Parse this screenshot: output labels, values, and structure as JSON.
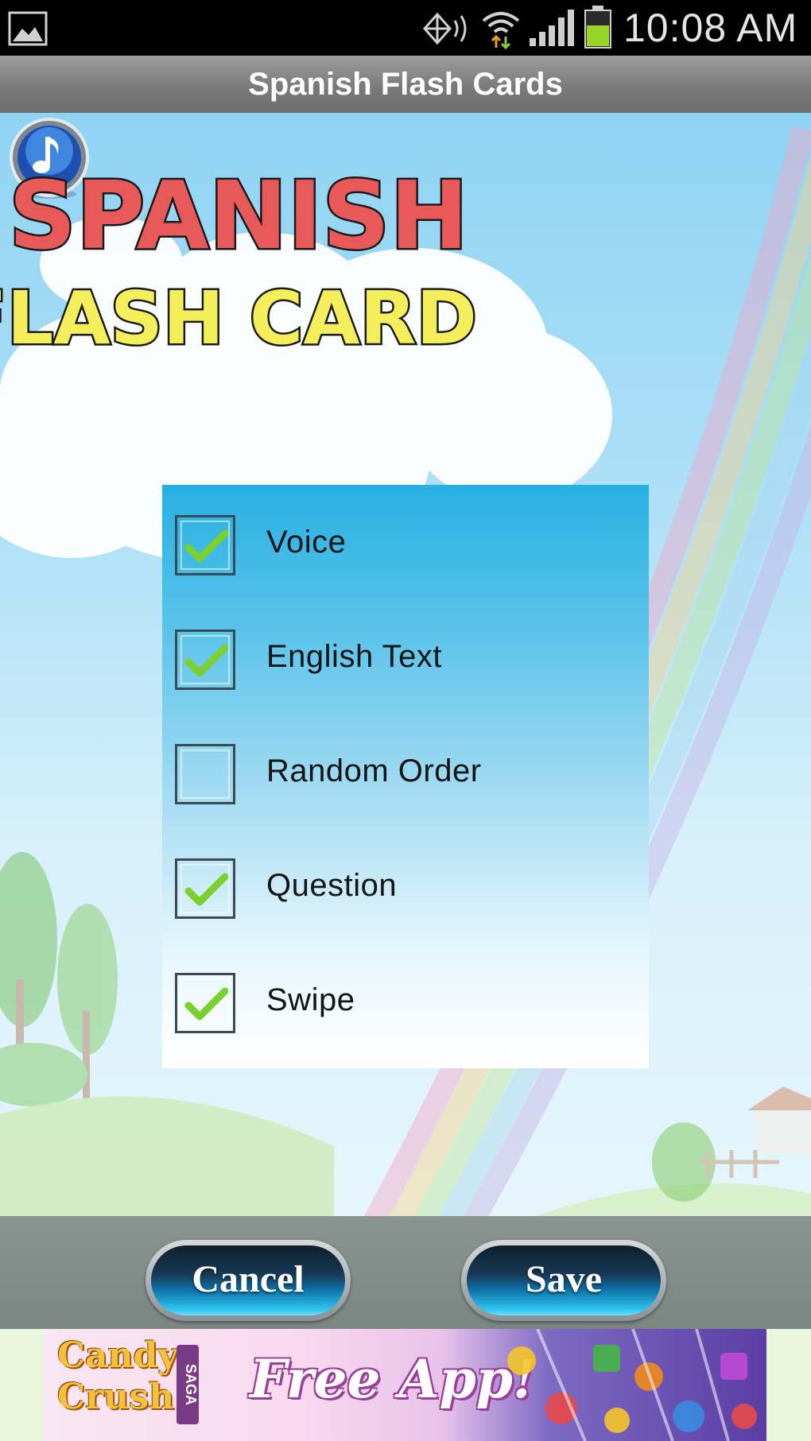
{
  "status_bar": {
    "time": "10:08 AM",
    "icons": [
      "gallery-icon",
      "sync-icon",
      "wifi-icon",
      "signal-icon",
      "battery-icon"
    ]
  },
  "title_bar": {
    "title": "Spanish Flash Cards"
  },
  "logo": {
    "line1": "SPANISH",
    "line2": "FLASH CARDS",
    "colors": {
      "line1": "#e85a5a",
      "line2": "#f4ee5a"
    }
  },
  "music_button": {
    "icon": "music-note-icon"
  },
  "options": [
    {
      "label": "Voice",
      "checked": true
    },
    {
      "label": "English Text",
      "checked": true
    },
    {
      "label": "Random Order",
      "checked": false
    },
    {
      "label": "Question",
      "checked": true
    },
    {
      "label": "Swipe",
      "checked": true
    }
  ],
  "buttons": {
    "cancel_label": "Cancel",
    "save_label": "Save"
  },
  "ad": {
    "brand": "Candy Crush",
    "saga": "SAGA",
    "headline": "Free App!"
  },
  "colors": {
    "checkmark": "#7bd02b",
    "panel_top": "#27b0e2",
    "title_bar": "#8a8a8a"
  }
}
